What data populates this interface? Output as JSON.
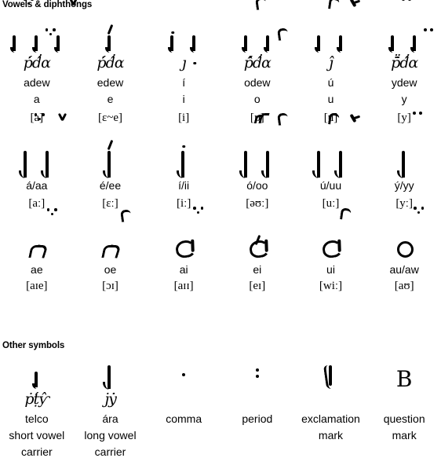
{
  "sections": {
    "vowels": {
      "title": "Vowels & diphthongs",
      "rows": [
        {
          "id": "short-vowels",
          "cells": [
            {
              "tengwar_word": "adew",
              "romanization": "adew",
              "letter": "a",
              "ipa": "[a]",
              "marks": [
                "three-dot",
                "three-dot-below",
                "circumflex"
              ]
            },
            {
              "tengwar_word": "edew",
              "romanization": "edew",
              "letter": "e",
              "ipa": "[ɛ~e]",
              "marks": [
                "acute"
              ]
            },
            {
              "tengwar_word": "i",
              "romanization": "í",
              "letter": "i",
              "ipa": "[i]",
              "marks": [
                "dot",
                "dot-below"
              ]
            },
            {
              "tengwar_word": "odew",
              "romanization": "odew",
              "letter": "o",
              "ipa": "[ɒ]",
              "marks": [
                "hook",
                "hook-below"
              ]
            },
            {
              "tengwar_word": "u",
              "romanization": "ú",
              "letter": "u",
              "ipa": "[u]",
              "marks": [
                "hook-right",
                "lambda"
              ]
            },
            {
              "tengwar_word": "ydew",
              "romanization": "ydew",
              "letter": "y",
              "ipa": "[y]",
              "marks": [
                "two-dot",
                "two-dot-below"
              ]
            }
          ]
        },
        {
          "id": "long-vowels",
          "cells": [
            {
              "romanization": "á/aa",
              "ipa": "[aː]",
              "marks": [
                "three-dot",
                "circumflex"
              ]
            },
            {
              "romanization": "é/ee",
              "ipa": "[ɛː]",
              "marks": [
                "acute"
              ]
            },
            {
              "romanization": "í/ii",
              "ipa": "[iː]",
              "marks": [
                "dot"
              ]
            },
            {
              "romanization": "ó/oo",
              "ipa": "[əʊː]",
              "marks": [
                "wave",
                "hook"
              ]
            },
            {
              "romanization": "ú/uu",
              "ipa": "[uː]",
              "marks": [
                "hook-right",
                "lambda"
              ]
            },
            {
              "romanization": "ý/yy",
              "ipa": "[yː]",
              "marks": [
                "two-dot"
              ]
            }
          ]
        },
        {
          "id": "diphthongs",
          "cells": [
            {
              "romanization": "ae",
              "ipa": "[aɪe]",
              "glyph": "lambe",
              "marks": [
                "three-dot"
              ]
            },
            {
              "romanization": "oe",
              "ipa": "[ɔɪ]",
              "glyph": "lambe",
              "marks": [
                "hook"
              ]
            },
            {
              "romanization": "ai",
              "ipa": "[aɪɪ]",
              "glyph": "curl",
              "marks": [
                "three-dot"
              ]
            },
            {
              "romanization": "ei",
              "ipa": "[eɪ]",
              "glyph": "curl",
              "marks": [
                "acute"
              ]
            },
            {
              "romanization": "ui",
              "ipa": "[wiː]",
              "glyph": "curl",
              "marks": [
                "hook-right"
              ]
            },
            {
              "romanization": "au/aw",
              "ipa": "[aʊ]",
              "glyph": "ring",
              "marks": [
                "three-dot"
              ]
            }
          ]
        }
      ]
    },
    "other": {
      "title": "Other symbols",
      "cells": [
        {
          "glyph": "telco",
          "tengwar_word": "telco",
          "name": "telco",
          "desc_line1": "short vowel",
          "desc_line2": "carrier"
        },
        {
          "glyph": "ara",
          "tengwar_word": "ára",
          "name": "ára",
          "desc_line1": "long vowel",
          "desc_line2": "carrier"
        },
        {
          "glyph": "comma",
          "name": "comma",
          "desc_line1": "",
          "desc_line2": ""
        },
        {
          "glyph": "period",
          "name": "period",
          "desc_line1": "",
          "desc_line2": ""
        },
        {
          "glyph": "exclamation",
          "name": "exclamation",
          "desc_line1": "mark",
          "desc_line2": ""
        },
        {
          "glyph": "question",
          "name": "question",
          "desc_line1": "mark",
          "desc_line2": ""
        }
      ]
    }
  },
  "colors": {
    "text": "#000000",
    "background": "#ffffff"
  }
}
